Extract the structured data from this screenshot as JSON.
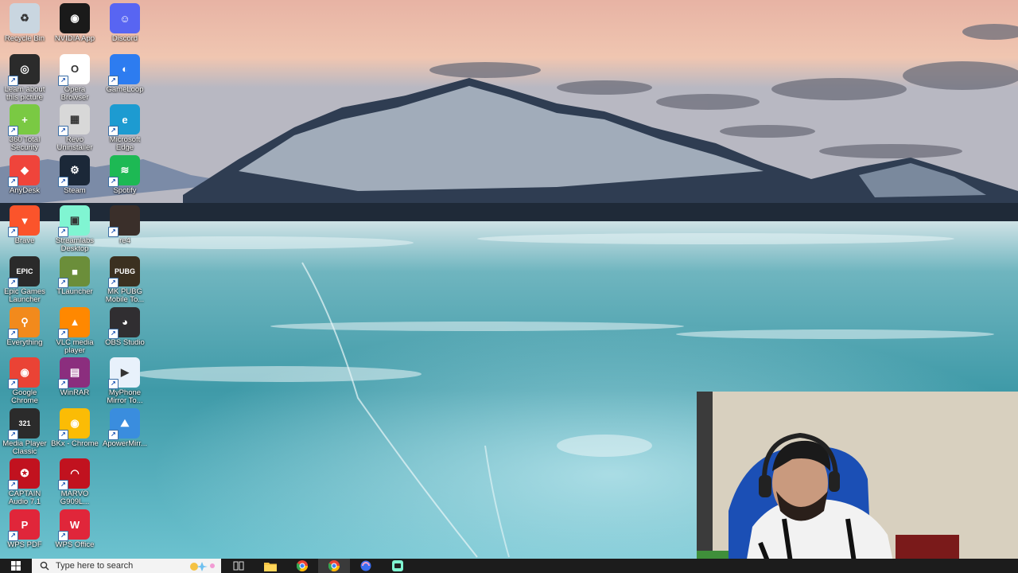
{
  "desktop": {
    "icons": [
      {
        "label": "Recycle Bin",
        "icon": "recycle-bin-icon",
        "color": "#c9d6e0",
        "glyph": "♻"
      },
      {
        "label": "NVIDIA App",
        "icon": "nvidia-icon",
        "color": "#1a1a1a",
        "glyph": "◉"
      },
      {
        "label": "Discord",
        "icon": "discord-icon",
        "color": "#5865f2",
        "glyph": "☺"
      },
      {
        "label": "Learn about\nthis picture",
        "icon": "camera-icon",
        "color": "#2b2b2b",
        "glyph": "◎"
      },
      {
        "label": "Opera\nBrowser",
        "icon": "opera-icon",
        "color": "#ffffff",
        "glyph": "O"
      },
      {
        "label": "GameLoop",
        "icon": "gameloop-icon",
        "color": "#2d7cf0",
        "glyph": "◐"
      },
      {
        "label": "360 Total\nSecurity",
        "icon": "shield-plus-icon",
        "color": "#7ac943",
        "glyph": "+"
      },
      {
        "label": "Revo\nUninstaller",
        "icon": "revo-icon",
        "color": "#d8d8d8",
        "glyph": "▦"
      },
      {
        "label": "Microsoft\nEdge",
        "icon": "edge-icon",
        "color": "#1d9bd1",
        "glyph": "e"
      },
      {
        "label": "AnyDesk",
        "icon": "anydesk-icon",
        "color": "#ef443b",
        "glyph": "◆"
      },
      {
        "label": "Steam",
        "icon": "steam-icon",
        "color": "#1b2838",
        "glyph": "⚙"
      },
      {
        "label": "Spotify",
        "icon": "spotify-icon",
        "color": "#1db954",
        "glyph": "≋"
      },
      {
        "label": "Brave",
        "icon": "brave-icon",
        "color": "#fb542b",
        "glyph": "▼"
      },
      {
        "label": "Streamlabs\nDesktop",
        "icon": "streamlabs-icon",
        "color": "#80f5d2",
        "glyph": "▣"
      },
      {
        "label": "re4",
        "icon": "re4-thumbnail-icon",
        "color": "#3a2f2a",
        "glyph": ""
      },
      {
        "label": "Epic Games\nLauncher",
        "icon": "epic-games-icon",
        "color": "#2a2a2a",
        "glyph": "EPIC"
      },
      {
        "label": "TLauncher",
        "icon": "tlauncher-icon",
        "color": "#6b8e3a",
        "glyph": "■"
      },
      {
        "label": "MK PUBG\nMobile To...",
        "icon": "pubg-icon",
        "color": "#3b3020",
        "glyph": "PUBG"
      },
      {
        "label": "Everything",
        "icon": "everything-icon",
        "color": "#f28a1c",
        "glyph": "⚲"
      },
      {
        "label": "VLC media\nplayer",
        "icon": "vlc-icon",
        "color": "#ff8800",
        "glyph": "▲"
      },
      {
        "label": "OBS Studio",
        "icon": "obs-icon",
        "color": "#302e31",
        "glyph": "◕"
      },
      {
        "label": "Google\nChrome",
        "icon": "chrome-icon",
        "color": "#ea4335",
        "glyph": "◉"
      },
      {
        "label": "WinRAR",
        "icon": "winrar-icon",
        "color": "#8b2e7e",
        "glyph": "▤"
      },
      {
        "label": "MyPhone\nMirror To...",
        "icon": "myphone-icon",
        "color": "#e8f1fb",
        "glyph": "▶"
      },
      {
        "label": "Media Player\nClassic",
        "icon": "mpc-icon",
        "color": "#2b2b2b",
        "glyph": "321"
      },
      {
        "label": "BKx - Chrome",
        "icon": "chrome-profile-icon",
        "color": "#fbbc05",
        "glyph": "◉"
      },
      {
        "label": "ApowerMirr...",
        "icon": "apowermirror-icon",
        "color": "#3a8dde",
        "glyph": "⛰"
      },
      {
        "label": "CAPTAIN\nAudio 7.1",
        "icon": "captain-audio-icon",
        "color": "#c1121f",
        "glyph": "✪"
      },
      {
        "label": "MARVO\nG909L...",
        "icon": "marvo-icon",
        "color": "#c1121f",
        "glyph": "◠"
      },
      {
        "label": "",
        "icon": "",
        "color": "",
        "glyph": ""
      },
      {
        "label": "WPS PDF",
        "icon": "wps-pdf-icon",
        "color": "#e0263a",
        "glyph": "P"
      },
      {
        "label": "WPS Office",
        "icon": "wps-office-icon",
        "color": "#e0263a",
        "glyph": "W"
      }
    ]
  },
  "taskbar": {
    "search_placeholder": "Type here to search",
    "items": [
      {
        "icon": "task-view-icon",
        "active": false
      },
      {
        "icon": "file-explorer-icon",
        "active": false
      },
      {
        "icon": "chrome-taskbar-icon",
        "active": false
      },
      {
        "icon": "chrome-profile-taskbar-icon",
        "active": true
      },
      {
        "icon": "gameloop-taskbar-icon",
        "active": false
      },
      {
        "icon": "streamlabs-taskbar-icon",
        "active": false
      }
    ]
  },
  "colors": {
    "taskbar_bg": "#1c1c1c",
    "sky_top": "#e9b8a6",
    "water": "#4aa7b2"
  }
}
